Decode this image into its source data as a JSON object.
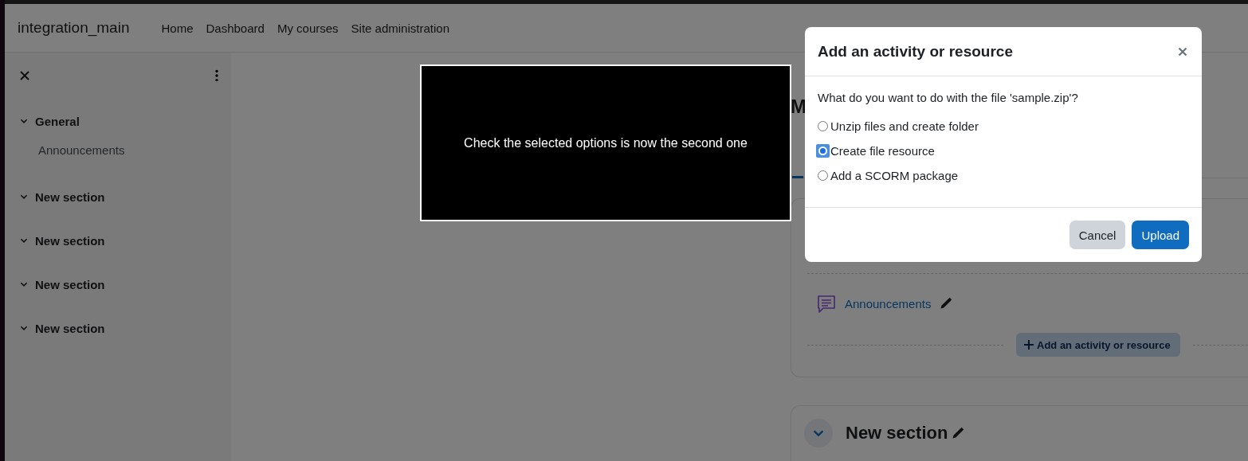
{
  "site_name": "integration_main",
  "nav": [
    "Home",
    "Dashboard",
    "My courses",
    "Site administration"
  ],
  "sidebar": {
    "sections": [
      {
        "title": "General",
        "children": [
          {
            "label": "Announcements"
          }
        ]
      },
      {
        "title": "New section"
      },
      {
        "title": "New section"
      },
      {
        "title": "New section"
      },
      {
        "title": "New section"
      }
    ]
  },
  "course": {
    "heading": "M",
    "activity": {
      "label": "Announcements"
    },
    "add_button": "Add an activity or resource",
    "next_section": {
      "title": "New section"
    }
  },
  "annotation": {
    "text": "Check the selected options is now the second one"
  },
  "dialog": {
    "title": "Add an activity or resource",
    "question": "What do you want to do with the file 'sample.zip'?",
    "options": [
      {
        "label": "Unzip files and create folder",
        "selected": false
      },
      {
        "label": "Create file resource",
        "selected": true
      },
      {
        "label": "Add a SCORM package",
        "selected": false
      }
    ],
    "buttons": [
      {
        "label": "Cancel",
        "kind": "secondary"
      },
      {
        "label": "Upload",
        "kind": "primary"
      }
    ]
  }
}
